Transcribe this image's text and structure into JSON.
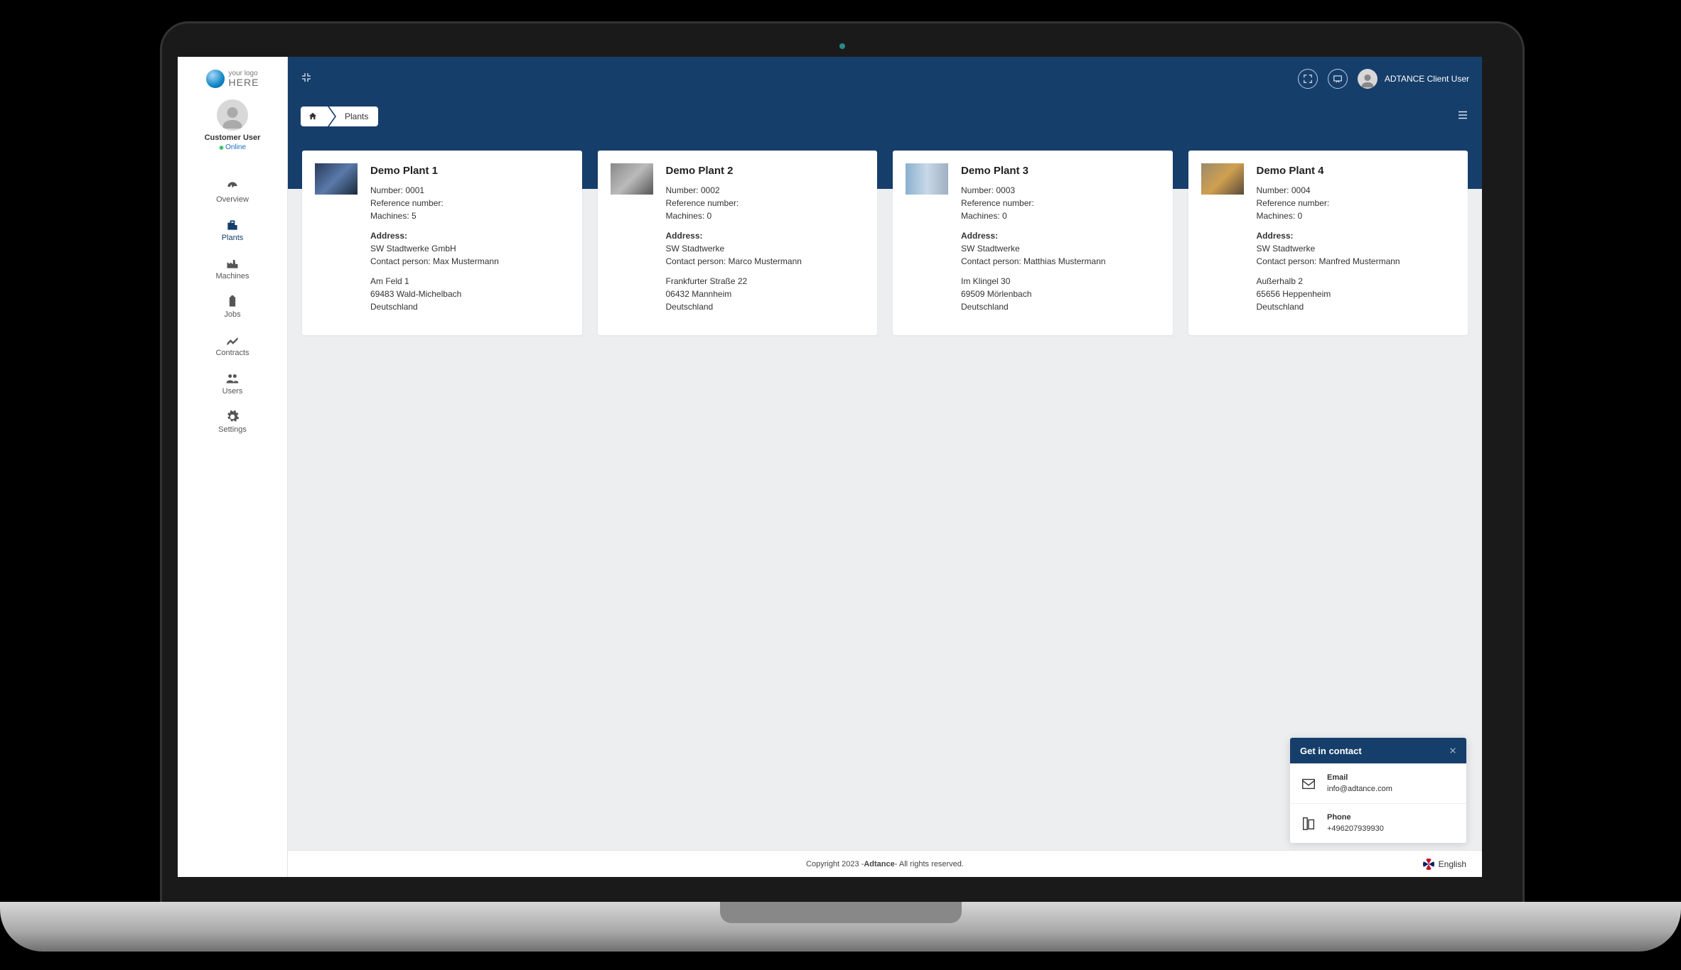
{
  "logo": {
    "line1": "your logo",
    "line2": "HERE"
  },
  "sidebar": {
    "user_role": "Customer User",
    "user_status": "Online",
    "items": [
      {
        "label": "Overview",
        "icon": "dashboard-icon"
      },
      {
        "label": "Plants",
        "icon": "building-icon"
      },
      {
        "label": "Machines",
        "icon": "factory-icon"
      },
      {
        "label": "Jobs",
        "icon": "clipboard-icon"
      },
      {
        "label": "Contracts",
        "icon": "signature-icon"
      },
      {
        "label": "Users",
        "icon": "users-icon"
      },
      {
        "label": "Settings",
        "icon": "gears-icon"
      }
    ]
  },
  "topbar": {
    "user_name": "ADTANCE Client User"
  },
  "breadcrumb": {
    "current": "Plants"
  },
  "plants": [
    {
      "title": "Demo Plant 1",
      "number": "Number: 0001",
      "ref": "Reference number:",
      "machines": "Machines: 5",
      "address_label": "Address:",
      "company": "SW Stadtwerke GmbH",
      "contact": "Contact person: Max Mustermann",
      "street": "Am Feld 1",
      "city": "69483 Wald-Michelbach",
      "country": "Deutschland"
    },
    {
      "title": "Demo Plant 2",
      "number": "Number: 0002",
      "ref": "Reference number:",
      "machines": "Machines: 0",
      "address_label": "Address:",
      "company": "SW Stadtwerke",
      "contact": "Contact person: Marco Mustermann",
      "street": "Frankfurter Straße 22",
      "city": "06432 Mannheim",
      "country": "Deutschland"
    },
    {
      "title": "Demo Plant 3",
      "number": "Number: 0003",
      "ref": "Reference number:",
      "machines": "Machines: 0",
      "address_label": "Address:",
      "company": "SW Stadtwerke",
      "contact": "Contact person: Matthias Mustermann",
      "street": "Im Klingel 30",
      "city": "69509 Mörlenbach",
      "country": "Deutschland"
    },
    {
      "title": "Demo Plant 4",
      "number": "Number: 0004",
      "ref": "Reference number:",
      "machines": "Machines: 0",
      "address_label": "Address:",
      "company": "SW Stadtwerke",
      "contact": "Contact person: Manfred Mustermann",
      "street": "Außerhalb 2",
      "city": "65656 Heppenheim",
      "country": "Deutschland"
    }
  ],
  "contact_panel": {
    "title": "Get in contact",
    "email_label": "Email",
    "email_value": "info@adtance.com",
    "phone_label": "Phone",
    "phone_value": "+496207939930"
  },
  "footer": {
    "left": "Copyright 2023 - ",
    "brand": "Adtance",
    "right": " - All rights reserved.",
    "language": "English"
  }
}
